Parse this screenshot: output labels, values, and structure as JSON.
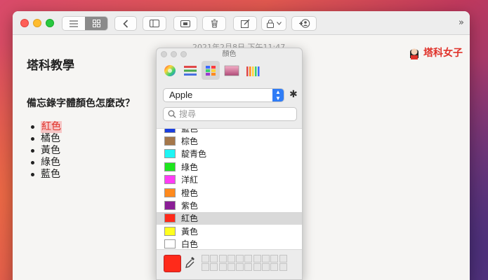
{
  "window": {
    "date": "2021年2月8日 下午11:47"
  },
  "note": {
    "title": "塔科教學",
    "question": "備忘錄字體顏色怎麼改？",
    "items": [
      "紅色",
      "橘色",
      "黃色",
      "綠色",
      "藍色"
    ]
  },
  "brand": {
    "name": "塔科女子"
  },
  "colors_panel": {
    "title": "顏色",
    "palette_name": "Apple",
    "search_placeholder": "搜尋",
    "current_color": "#ff2a1a",
    "selected": "紅色",
    "rows": [
      {
        "name": "藍色",
        "color": "#1a3fe0"
      },
      {
        "name": "棕色",
        "color": "#a5774a"
      },
      {
        "name": "靛青色",
        "color": "#1ef5f5"
      },
      {
        "name": "綠色",
        "color": "#1ee61e"
      },
      {
        "name": "洋紅",
        "color": "#ff3cf5"
      },
      {
        "name": "橙色",
        "color": "#ff8a1e"
      },
      {
        "name": "紫色",
        "color": "#8a1e96"
      },
      {
        "name": "紅色",
        "color": "#ff2a1a"
      },
      {
        "name": "黃色",
        "color": "#ffff1e"
      },
      {
        "name": "白色",
        "color": "#ffffff"
      }
    ]
  }
}
